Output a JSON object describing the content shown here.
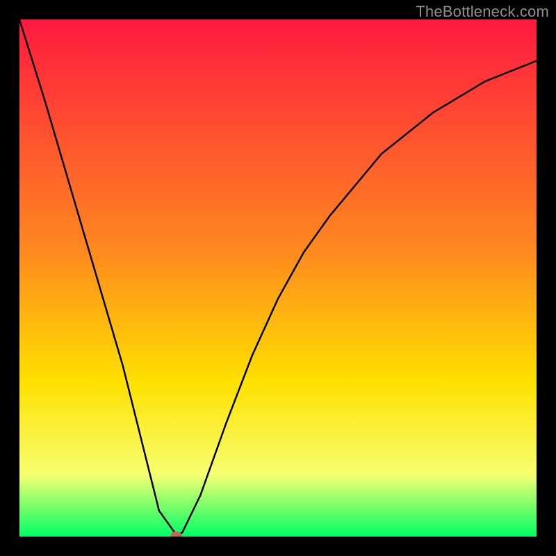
{
  "attribution": "TheBottleneck.com",
  "colors": {
    "top": "#ff1a3f",
    "mid1": "#ff8a1f",
    "mid2": "#ffe000",
    "mid3": "#f7ff70",
    "bottom": "#00ff66",
    "curve": "#000000",
    "marker": "#c9655a",
    "frame": "#000000"
  },
  "chart_data": {
    "type": "line",
    "title": "",
    "xlabel": "",
    "ylabel": "",
    "xlim": [
      0,
      100
    ],
    "ylim": [
      0,
      100
    ],
    "x": [
      0,
      5,
      10,
      15,
      20,
      24,
      27,
      30,
      30.2,
      30.5,
      31.5,
      35,
      40,
      45,
      50,
      55,
      60,
      65,
      70,
      75,
      80,
      85,
      90,
      95,
      100
    ],
    "values": [
      100,
      84,
      67,
      50,
      33,
      17,
      5,
      0.8,
      0.3,
      0.3,
      0.8,
      8,
      22,
      35,
      46,
      55,
      62,
      68,
      74,
      78,
      82,
      85,
      88,
      90,
      92
    ],
    "marker": {
      "x": 30.3,
      "y": 0.3
    }
  }
}
